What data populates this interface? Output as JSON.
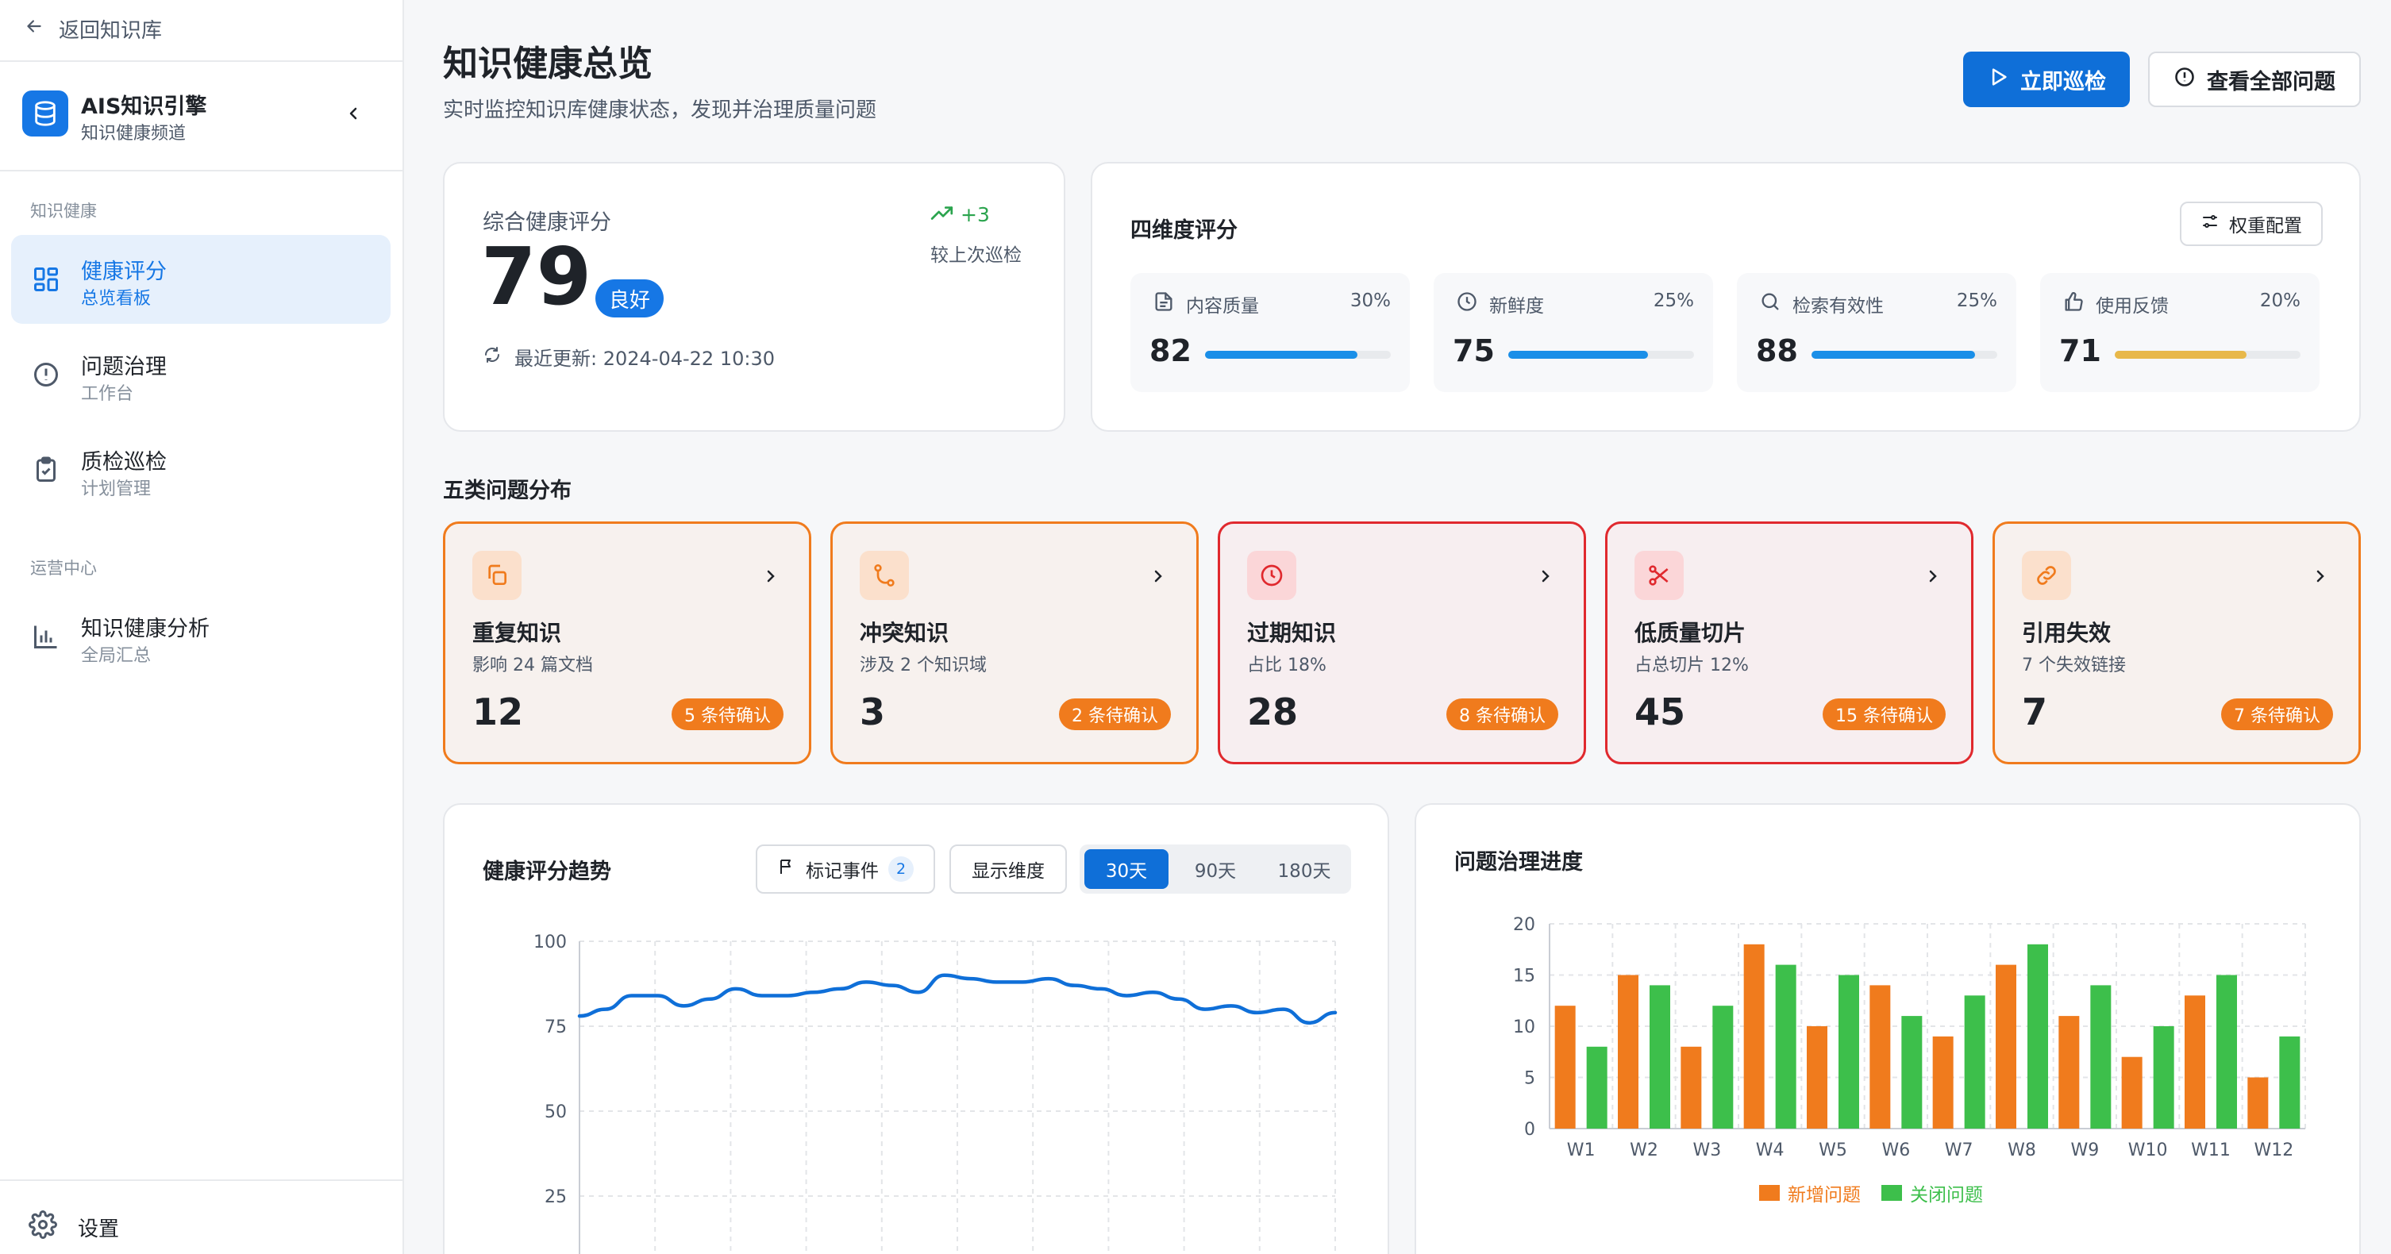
{
  "sidebar": {
    "back_label": "返回知识库",
    "brand_title": "AIS知识引擎",
    "brand_sub": "知识健康频道",
    "section1": "知识健康",
    "section2": "运营中心",
    "items": [
      {
        "title": "健康评分",
        "sub": "总览看板"
      },
      {
        "title": "问题治理",
        "sub": "工作台"
      },
      {
        "title": "质检巡检",
        "sub": "计划管理"
      },
      {
        "title": "知识健康分析",
        "sub": "全局汇总"
      }
    ],
    "settings_label": "设置"
  },
  "header": {
    "title": "知识健康总览",
    "subtitle": "实时监控知识库健康状态，发现并治理质量问题",
    "primary_btn": "立即巡检",
    "secondary_btn": "查看全部问题"
  },
  "score": {
    "label": "综合健康评分",
    "value": "79",
    "badge": "良好",
    "updated": "最近更新: 2024-04-22 10:30",
    "trend": "+3",
    "trend_sub": "较上次巡检"
  },
  "dimensions": {
    "title": "四维度评分",
    "weight_btn": "权重配置",
    "items": [
      {
        "label": "内容质量",
        "pct": "30%",
        "value": "82",
        "fill": 0.82,
        "color": "#1a8fe8"
      },
      {
        "label": "新鲜度",
        "pct": "25%",
        "value": "75",
        "fill": 0.75,
        "color": "#1a8fe8"
      },
      {
        "label": "检索有效性",
        "pct": "25%",
        "value": "88",
        "fill": 0.88,
        "color": "#1a8fe8"
      },
      {
        "label": "使用反馈",
        "pct": "20%",
        "value": "71",
        "fill": 0.71,
        "color": "#e8b84a"
      }
    ]
  },
  "issues": {
    "title": "五类问题分布",
    "items": [
      {
        "title": "重复知识",
        "sub": "影响 24 篇文档",
        "value": "12",
        "pill": "5 条待确认",
        "tone": "orange",
        "icon": "copy-icon"
      },
      {
        "title": "冲突知识",
        "sub": "涉及 2 个知识域",
        "value": "3",
        "pill": "2 条待确认",
        "tone": "orange",
        "icon": "git-merge-icon"
      },
      {
        "title": "过期知识",
        "sub": "占比 18%",
        "value": "28",
        "pill": "8 条待确认",
        "tone": "red",
        "icon": "clock-icon"
      },
      {
        "title": "低质量切片",
        "sub": "占总切片 12%",
        "value": "45",
        "pill": "15 条待确认",
        "tone": "red",
        "icon": "scissors-icon"
      },
      {
        "title": "引用失效",
        "sub": "7 个失效链接",
        "value": "7",
        "pill": "7 条待确认",
        "tone": "orange",
        "icon": "link-icon"
      }
    ]
  },
  "trend_chart": {
    "title": "健康评分趋势",
    "mark_btn": "标记事件",
    "mark_count": "2",
    "dim_btn": "显示维度",
    "ranges": [
      "30天",
      "90天",
      "180天"
    ],
    "active_range": "30天"
  },
  "progress_chart": {
    "title": "问题治理进度"
  },
  "colors": {
    "primary": "#0f6fd8",
    "orange": "#f07b1d",
    "green": "#3dbf4b",
    "red": "#e0292e"
  },
  "chart_data": [
    {
      "type": "line",
      "title": "健康评分趋势",
      "yticks": [
        "100",
        "75",
        "50",
        "25"
      ],
      "ylim": [
        0,
        100
      ],
      "series": [
        {
          "values": [
            78,
            80,
            84,
            84,
            81,
            83,
            86,
            84,
            84,
            85,
            86,
            88,
            87,
            85,
            90,
            89,
            88,
            88,
            89,
            87,
            86,
            84,
            85,
            83,
            80,
            81,
            79,
            80,
            76,
            79
          ]
        }
      ],
      "grid": true
    },
    {
      "type": "bar",
      "title": "问题治理进度",
      "categories": [
        "W1",
        "W2",
        "W3",
        "W4",
        "W5",
        "W6",
        "W7",
        "W8",
        "W9",
        "W10",
        "W11",
        "W12"
      ],
      "yticks": [
        "20",
        "15",
        "10",
        "5",
        "0"
      ],
      "ylim": [
        0,
        20
      ],
      "series": [
        {
          "name": "新增问题",
          "color": "#f07b1d",
          "values": [
            12,
            15,
            8,
            18,
            10,
            14,
            9,
            16,
            11,
            7,
            13,
            5
          ]
        },
        {
          "name": "关闭问题",
          "color": "#3dbf4b",
          "values": [
            8,
            14,
            12,
            16,
            15,
            11,
            13,
            18,
            14,
            10,
            15,
            9
          ]
        }
      ],
      "legend": "bottom",
      "grid": true
    }
  ]
}
